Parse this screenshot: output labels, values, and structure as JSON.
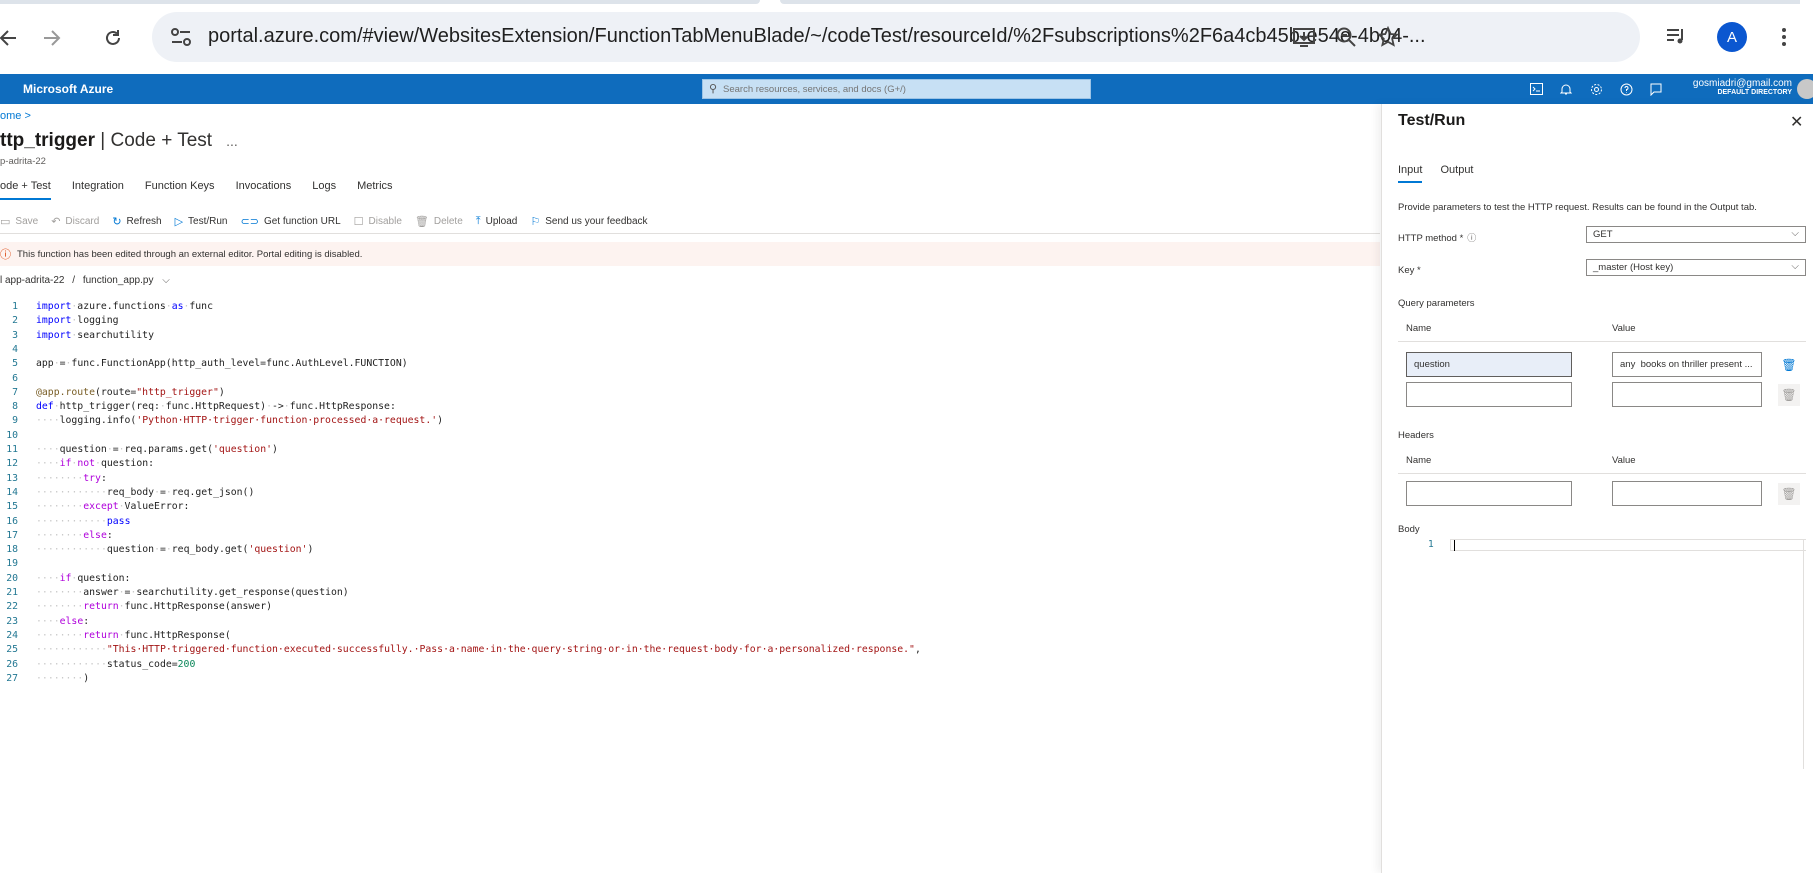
{
  "browser": {
    "url_host": "portal.azure.com",
    "url_path": "/#view/WebsitesExtension/FunctionTabMenuBlade/~/codeTest/resourceId/%2Fsubscriptions%2F6a4cb45b-e54e-4b04-...",
    "avatar_letter": "A",
    "icons": [
      "back-arrow-icon",
      "forward-arrow-icon",
      "reload-icon",
      "site-info-icon",
      "install-app-icon",
      "zoom-icon",
      "bookmark-star-icon",
      "media-icon",
      "menu-icon"
    ]
  },
  "azure": {
    "brand": "Microsoft Azure",
    "search_placeholder": "Search resources, services, and docs (G+/)",
    "user_email": "gosmiadri@gmail.com",
    "user_directory": "DEFAULT DIRECTORY",
    "accent_color": "#0f6cbd"
  },
  "page": {
    "breadcrumb": "ome  >",
    "title_bold": "ttp_trigger",
    "title_rest": " | Code + Test",
    "title_more": "...",
    "subtitle": "p-adrita-22",
    "tabs": [
      "ode + Test",
      "Integration",
      "Function Keys",
      "Invocations",
      "Logs",
      "Metrics"
    ],
    "toolbar": [
      {
        "label": "Save",
        "icon": "save-icon",
        "disabled": true
      },
      {
        "label": "Discard",
        "icon": "discard-icon",
        "disabled": true
      },
      {
        "label": "Refresh",
        "icon": "refresh-icon",
        "disabled": false
      },
      {
        "label": "Test/Run",
        "icon": "play-icon",
        "disabled": false
      },
      {
        "label": "Get function URL",
        "icon": "link-icon",
        "disabled": false
      },
      {
        "label": "Disable",
        "icon": "checkbox-icon",
        "disabled": true
      },
      {
        "label": "Delete",
        "icon": "trash-icon",
        "disabled": true
      },
      {
        "label": "Upload",
        "icon": "upload-icon",
        "disabled": false
      },
      {
        "label": "Send us your feedback",
        "icon": "feedback-icon",
        "disabled": false
      }
    ],
    "warning": "This function has been edited through an external editor. Portal editing is disabled.",
    "file_path_app": "l app-adrita-22",
    "file_path_sep": "/",
    "file_path_file": "function_app.py"
  },
  "code_lines": [
    "import·azure.functions·as·func",
    "import·logging",
    "import·searchutility",
    "",
    "app·=·func.FunctionApp(http_auth_level=func.AuthLevel.FUNCTION)",
    "",
    "@app.route(route=\"http_trigger\")",
    "def·http_trigger(req:·func.HttpRequest)·->·func.HttpResponse:",
    "····logging.info('Python·HTTP·trigger·function·processed·a·request.')",
    "",
    "····question·=·req.params.get('question')",
    "····if·not·question:",
    "········try:",
    "············req_body·=·req.get_json()",
    "········except·ValueError:",
    "············pass",
    "········else:",
    "············question·=·req_body.get('question')",
    "",
    "····if·question:",
    "········answer·=·searchutility.get_response(question)",
    "········return·func.HttpResponse(answer)",
    "····else:",
    "········return·func.HttpResponse(",
    "············\"This·HTTP·triggered·function·executed·successfully.·Pass·a·name·in·the·query·string·or·in·the·request·body·for·a·personalized·response.\",",
    "············status_code=200",
    "········)"
  ],
  "test_run": {
    "title": "Test/Run",
    "tabs": [
      "Input",
      "Output"
    ],
    "description": "Provide parameters to test the HTTP request. Results can be found in the Output tab.",
    "http_method_label": "HTTP method *",
    "http_method_value": "GET",
    "key_label": "Key *",
    "key_value": "_master (Host key)",
    "query_section": "Query parameters",
    "name_col": "Name",
    "value_col": "Value",
    "query_rows": [
      {
        "name": "question",
        "value": "any  books on thriller present ..."
      },
      {
        "name": "",
        "value": ""
      }
    ],
    "headers_section": "Headers",
    "header_rows": [
      {
        "name": "",
        "value": ""
      }
    ],
    "body_label": "Body",
    "body_line_number": "1"
  }
}
